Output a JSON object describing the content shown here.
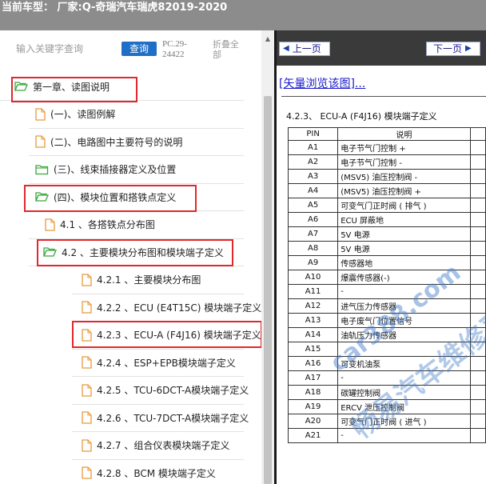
{
  "titlebar": {
    "text": "当前车型： 厂家:Q-奇瑞汽车瑞虎82019-2020"
  },
  "search": {
    "placeholder": "输入关键字查询",
    "query_label": "查询",
    "doc_code": "PC.29-24422",
    "collapse_label": "折叠全部"
  },
  "tree": {
    "items": [
      {
        "label": "第一章、读图说明",
        "icon": "folder-open-icon"
      },
      {
        "label": "(一)、读图例解",
        "icon": "document-icon"
      },
      {
        "label": "(二)、电路图中主要符号的说明",
        "icon": "document-icon"
      },
      {
        "label": "(三)、线束插接器定义及位置",
        "icon": "folder-closed-icon"
      },
      {
        "label": "(四)、模块位置和搭铁点定义",
        "icon": "folder-open-icon"
      },
      {
        "label": "4.1 、各搭铁点分布图",
        "icon": "document-icon"
      },
      {
        "label": "4.2 、主要模块分布图和模块端子定义",
        "icon": "folder-open-icon"
      },
      {
        "label": "4.2.1 、主要模块分布图",
        "icon": "document-icon"
      },
      {
        "label": "4.2.2 、ECU (E4T15C) 模块端子定义",
        "icon": "document-icon"
      },
      {
        "label": "4.2.3 、ECU-A (F4J16) 模块端子定义",
        "icon": "document-icon"
      },
      {
        "label": "4.2.4 、ESP+EPB模块端子定义",
        "icon": "document-icon"
      },
      {
        "label": "4.2.5 、TCU-6DCT-A模块端子定义",
        "icon": "document-icon"
      },
      {
        "label": "4.2.6 、TCU-7DCT-A模块端子定义",
        "icon": "document-icon"
      },
      {
        "label": "4.2.7 、组合仪表模块端子定义",
        "icon": "document-icon"
      },
      {
        "label": "4.2.8 、BCM 模块端子定义",
        "icon": "document-icon"
      }
    ]
  },
  "nav": {
    "prev_label": "上一页",
    "next_label": "下一页",
    "vector_link": "[矢量浏览该图]..."
  },
  "doc": {
    "section_title": "4.2.3、 ECU-A (F4J16) 模块端子定义",
    "col_pin": "PIN",
    "col_desc": "说明",
    "rows": [
      {
        "pin": "A1",
        "desc": "电子节气门控制 +"
      },
      {
        "pin": "A2",
        "desc": "电子节气门控制 -"
      },
      {
        "pin": "A3",
        "desc": "(MSV5) 油压控制阀 -"
      },
      {
        "pin": "A4",
        "desc": "(MSV5) 油压控制阀 +"
      },
      {
        "pin": "A5",
        "desc": "可变气门正时阀 ( 排气 )"
      },
      {
        "pin": "A6",
        "desc": "ECU 屏蔽地"
      },
      {
        "pin": "A7",
        "desc": "5V 电源"
      },
      {
        "pin": "A8",
        "desc": "5V 电源"
      },
      {
        "pin": "A9",
        "desc": "传感器地"
      },
      {
        "pin": "A10",
        "desc": "爆震传感器(-)"
      },
      {
        "pin": "A11",
        "desc": "-"
      },
      {
        "pin": "A12",
        "desc": "进气压力传感器"
      },
      {
        "pin": "A13",
        "desc": "电子废气门位置信号"
      },
      {
        "pin": "A14",
        "desc": "油轨压力传感器"
      },
      {
        "pin": "A15",
        "desc": ""
      },
      {
        "pin": "A16",
        "desc": "可变机油泵"
      },
      {
        "pin": "A17",
        "desc": "-"
      },
      {
        "pin": "A18",
        "desc": "碳罐控制阀"
      },
      {
        "pin": "A19",
        "desc": "ERCV 泄压控制阀"
      },
      {
        "pin": "A20",
        "desc": "可变气门正时阀 ( 进气 )"
      },
      {
        "pin": "A21",
        "desc": "-"
      }
    ]
  },
  "watermark": {
    "line1": "car388.com",
    "line2": "畅易汽车维修平台"
  },
  "colors": {
    "highlight": "#e0282e",
    "query_button": "#1f6fc6",
    "folder": "#3aa83a",
    "document": "#e89a3c"
  }
}
